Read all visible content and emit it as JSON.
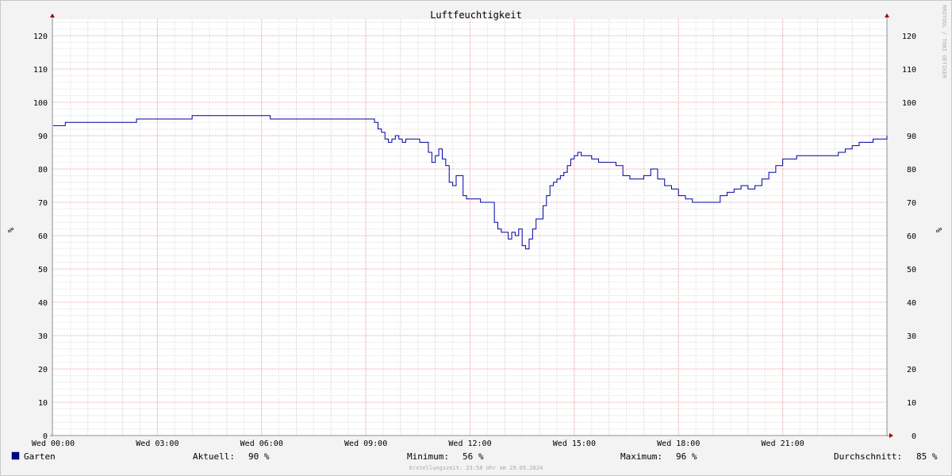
{
  "chart_data": {
    "type": "line",
    "title": "Luftfeuchtigkeit",
    "ylabel": "%",
    "ylim": [
      0,
      125
    ],
    "xlim_hours": [
      0,
      24
    ],
    "y_ticks": [
      0,
      10,
      20,
      30,
      40,
      50,
      60,
      70,
      80,
      90,
      100,
      110,
      120
    ],
    "x_ticks": [
      {
        "hour": 0,
        "label": "Wed 00:00"
      },
      {
        "hour": 3,
        "label": "Wed 03:00"
      },
      {
        "hour": 6,
        "label": "Wed 06:00"
      },
      {
        "hour": 9,
        "label": "Wed 09:00"
      },
      {
        "hour": 12,
        "label": "Wed 12:00"
      },
      {
        "hour": 15,
        "label": "Wed 15:00"
      },
      {
        "hour": 18,
        "label": "Wed 18:00"
      },
      {
        "hour": 21,
        "label": "Wed 21:00"
      }
    ],
    "grid": true,
    "watermark": "RRDTOOL / TOBI OETIKER",
    "series": [
      {
        "name": "Garten",
        "color": "#0000a0",
        "x_hours": [
          0,
          0.3,
          0.35,
          2.35,
          2.4,
          3.95,
          4.0,
          6.2,
          6.25,
          9.2,
          9.25,
          9.35,
          9.45,
          9.55,
          9.65,
          9.75,
          9.85,
          9.95,
          10.05,
          10.15,
          10.25,
          10.35,
          10.45,
          10.55,
          10.8,
          10.9,
          11.0,
          11.1,
          11.2,
          11.3,
          11.4,
          11.5,
          11.6,
          11.7,
          11.8,
          11.9,
          12.0,
          12.1,
          12.2,
          12.3,
          12.4,
          12.5,
          12.6,
          12.7,
          12.8,
          12.9,
          13.0,
          13.1,
          13.2,
          13.3,
          13.4,
          13.5,
          13.6,
          13.7,
          13.8,
          13.9,
          14.0,
          14.1,
          14.2,
          14.3,
          14.4,
          14.5,
          14.6,
          14.7,
          14.8,
          14.9,
          15.0,
          15.1,
          15.2,
          15.3,
          15.4,
          15.5,
          15.6,
          15.7,
          15.8,
          16.0,
          16.2,
          16.4,
          16.6,
          16.8,
          17.0,
          17.2,
          17.4,
          17.6,
          17.8,
          18.0,
          18.2,
          18.4,
          18.6,
          18.8,
          19.0,
          19.2,
          19.4,
          19.6,
          19.8,
          20.0,
          20.2,
          20.4,
          20.6,
          20.8,
          21.0,
          21.2,
          21.4,
          21.6,
          21.8,
          22.0,
          22.2,
          22.4,
          22.6,
          22.8,
          23.0,
          23.2,
          23.4,
          23.6,
          23.8,
          23.9,
          24.0
        ],
        "values": [
          93,
          93,
          94,
          94,
          95,
          95,
          96,
          96,
          95,
          95,
          94,
          92,
          91,
          89,
          88,
          89,
          90,
          89,
          88,
          89,
          89,
          89,
          89,
          88,
          85,
          82,
          84,
          86,
          83,
          81,
          76,
          75,
          78,
          78,
          72,
          71,
          71,
          71,
          71,
          70,
          70,
          70,
          70,
          64,
          62,
          61,
          61,
          59,
          61,
          60,
          62,
          57,
          56,
          59,
          62,
          65,
          65,
          69,
          72,
          75,
          76,
          77,
          78,
          79,
          81,
          83,
          84,
          85,
          84,
          84,
          84,
          83,
          83,
          82,
          82,
          82,
          81,
          78,
          77,
          77,
          78,
          80,
          77,
          75,
          74,
          72,
          71,
          70,
          70,
          70,
          70,
          72,
          73,
          74,
          75,
          74,
          75,
          77,
          79,
          81,
          83,
          83,
          84,
          84,
          84,
          84,
          84,
          84,
          85,
          86,
          87,
          88,
          88,
          89,
          89,
          89,
          90,
          90
        ]
      }
    ]
  },
  "legend": {
    "series_name": "Garten",
    "series_color": "#0000a0",
    "current_label": "Aktuell:",
    "current_value": "90 %",
    "min_label": "Minimum:",
    "min_value": "56 %",
    "max_label": "Maximum:",
    "max_value": "96 %",
    "avg_label": "Durchschnitt:",
    "avg_value": "85 %"
  },
  "footer": "Erstellungszeit: 23:58 Uhr am 29.05.2024"
}
